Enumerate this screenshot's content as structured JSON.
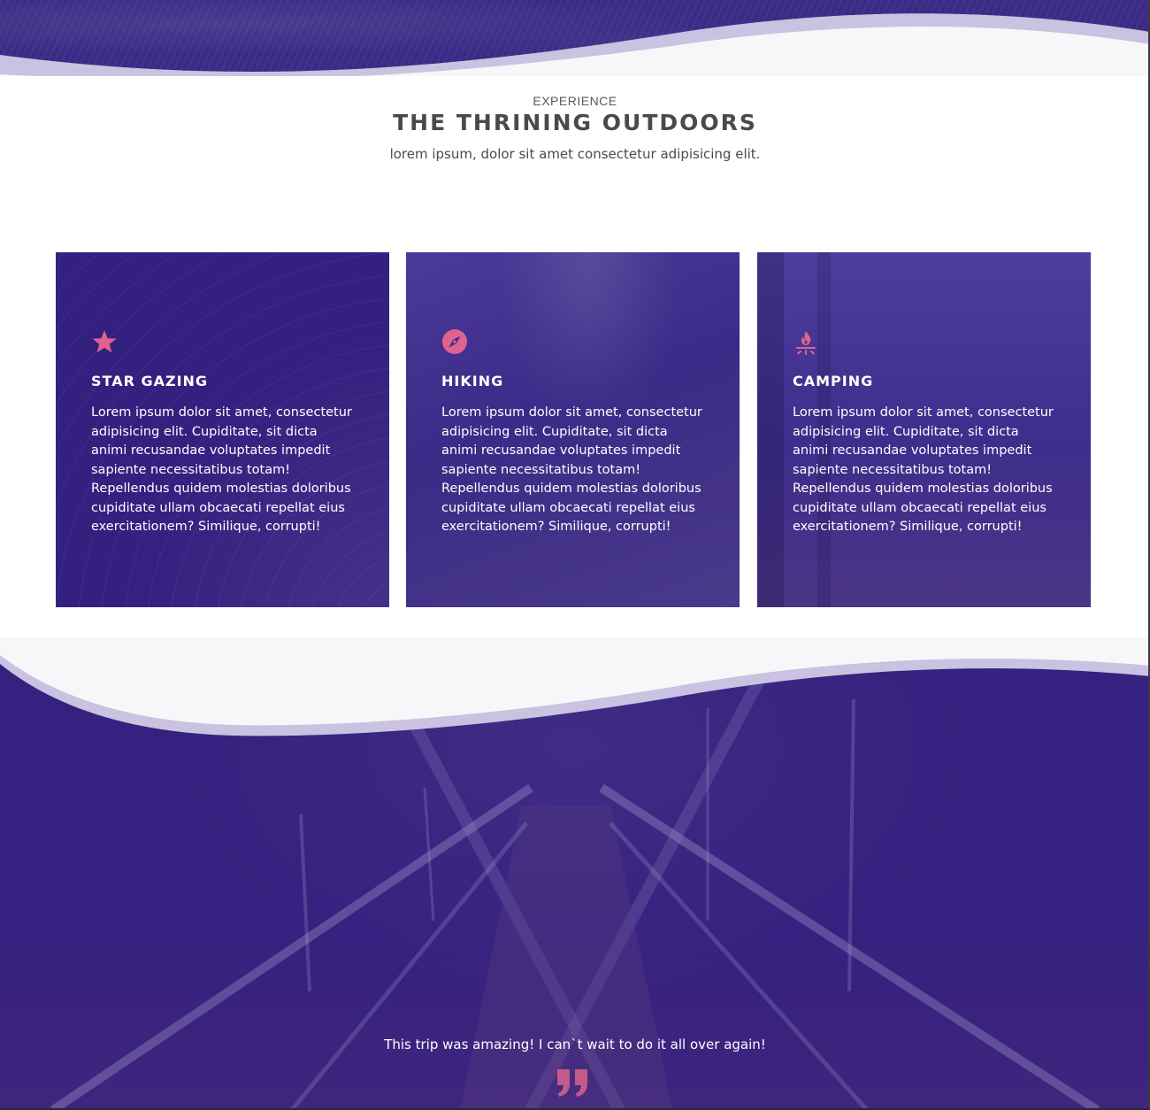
{
  "header": {
    "eyebrow": "EXPERIENCE",
    "title": "THE THRINING OUTDOORS",
    "subtitle": "lorem ipsum, dolor sit amet consectetur adipisicing elit."
  },
  "cards": [
    {
      "icon": "star-icon",
      "title": "STAR GAZING",
      "text": "Lorem ipsum dolor sit amet, consectetur adipisicing elit. Cupiditate, sit dicta animi recusandae voluptates impedit sapiente necessitatibus totam! Repellendus quidem molestias doloribus cupiditate ullam obcaecati repellat eius exercitationem? Similique, corrupti!"
    },
    {
      "icon": "compass-icon",
      "title": "HIKING",
      "text": "Lorem ipsum dolor sit amet, consectetur adipisicing elit. Cupiditate, sit dicta animi recusandae voluptates impedit sapiente necessitatibus totam! Repellendus quidem molestias doloribus cupiditate ullam obcaecati repellat eius exercitationem? Similique, corrupti!"
    },
    {
      "icon": "campfire-icon",
      "title": "CAMPING",
      "text": "Lorem ipsum dolor sit amet, consectetur adipisicing elit. Cupiditate, sit dicta animi recusandae voluptates impedit sapiente necessitatibus totam! Repellendus quidem molestias doloribus cupiditate ullam obcaecati repellat eius exercitationem? Similique, corrupti!"
    }
  ],
  "testimonial": {
    "text": "This trip was amazing! I can`t wait to do it all over again!",
    "icon": "quote-icon"
  },
  "colors": {
    "brand_purple": "#35217f",
    "accent_pink": "#e0628f",
    "heading_gray": "#4a4a4a"
  }
}
